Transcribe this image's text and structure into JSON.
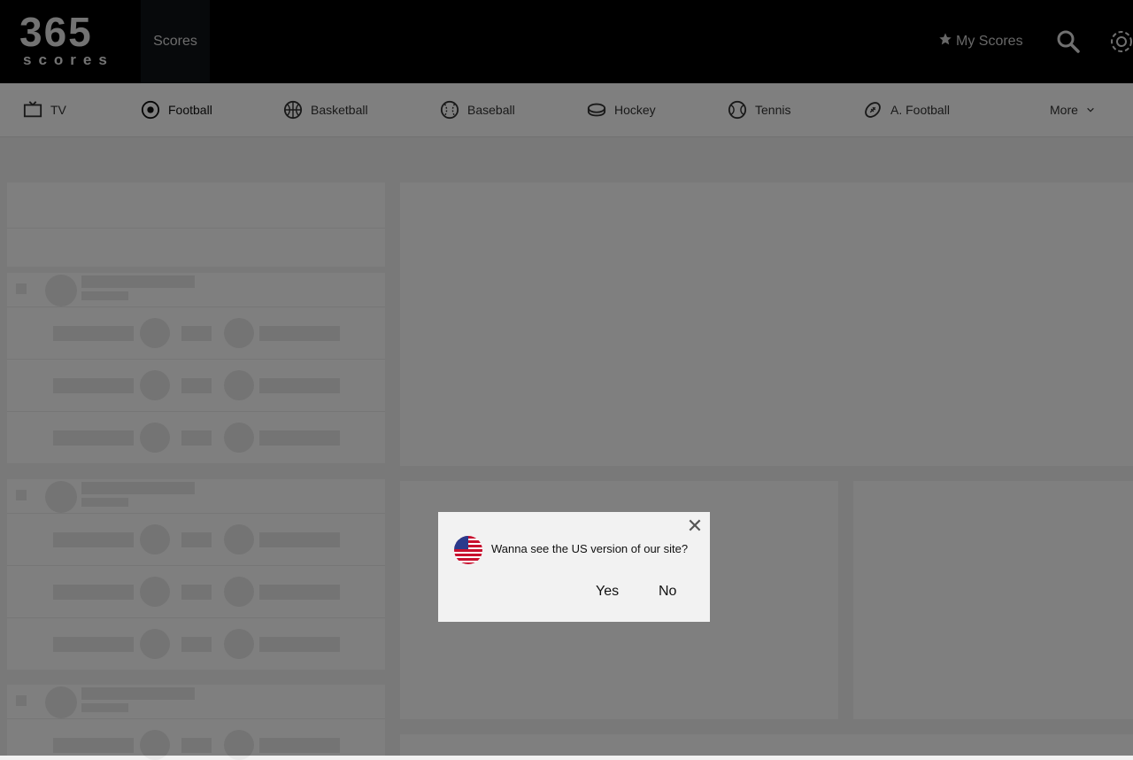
{
  "header": {
    "logo_digits": "365",
    "logo_word": "scores",
    "scores_tab": "Scores",
    "my_scores": "My Scores"
  },
  "sports": [
    {
      "label": "TV",
      "icon": "tv-icon"
    },
    {
      "label": "Football",
      "icon": "football-icon"
    },
    {
      "label": "Basketball",
      "icon": "basketball-icon"
    },
    {
      "label": "Baseball",
      "icon": "baseball-icon"
    },
    {
      "label": "Hockey",
      "icon": "hockey-icon"
    },
    {
      "label": "Tennis",
      "icon": "tennis-icon"
    },
    {
      "label": "A. Football",
      "icon": "american-football-icon"
    },
    {
      "label": "More",
      "icon": "chevron-down-icon"
    }
  ],
  "dialog": {
    "question": "Wanna see the US version of our site?",
    "yes": "Yes",
    "no": "No",
    "close": "✕"
  }
}
